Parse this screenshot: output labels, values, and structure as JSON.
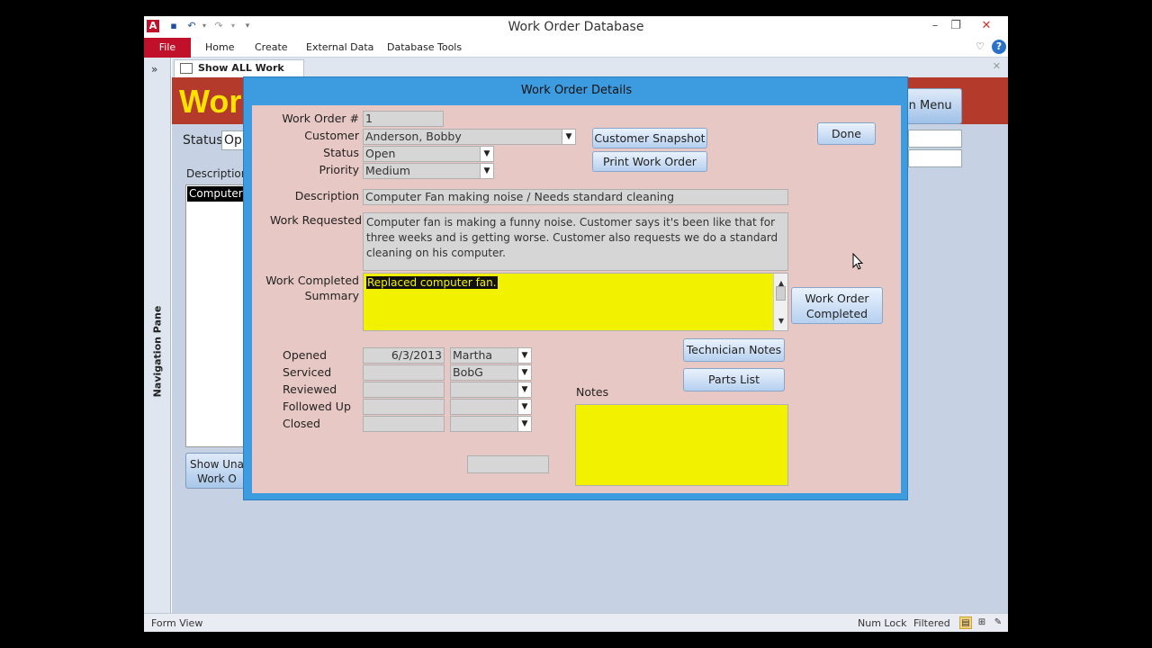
{
  "window": {
    "title": "Work Order Database",
    "qat_icons": [
      "access-icon",
      "save-icon",
      "undo-icon",
      "redo-icon",
      "customize-icon"
    ],
    "controls": [
      "minimize",
      "restore",
      "close"
    ]
  },
  "ribbon": {
    "tabs": [
      "File",
      "Home",
      "Create",
      "External Data",
      "Database Tools"
    ]
  },
  "nav_pane": {
    "toggle": "»",
    "label": "Navigation Pane"
  },
  "doc_tab": {
    "label": "Show ALL Work Orders"
  },
  "background_form": {
    "title": "Wor",
    "main_menu_label": "in Menu",
    "status_label": "Status",
    "status_value": "Op",
    "description_label": "Description",
    "list_selected": "Computer",
    "show_button_line1": "Show Una",
    "show_button_line2": "Work O"
  },
  "dialog": {
    "title": "Work Order Details",
    "labels": {
      "work_order": "Work Order #",
      "customer": "Customer",
      "status": "Status",
      "priority": "Priority",
      "description": "Description",
      "work_requested": "Work Requested",
      "work_completed_line1": "Work Completed",
      "work_completed_line2": "Summary",
      "opened": "Opened",
      "serviced": "Serviced",
      "reviewed": "Reviewed",
      "followed_up": "Followed Up",
      "closed": "Closed",
      "notes": "Notes"
    },
    "values": {
      "work_order": "1",
      "customer": "Anderson, Bobby",
      "status": "Open",
      "priority": "Medium",
      "description": "Computer Fan making noise / Needs standard cleaning",
      "work_requested": "Computer fan is making a funny noise. Customer says it's been like that for three weeks and is getting worse. Customer also requests we do a standard cleaning on his computer.",
      "work_completed": "Replaced computer fan.",
      "opened_date": "6/3/2013",
      "opened_by": "Martha",
      "serviced_date": "",
      "serviced_by": "BobG",
      "reviewed_date": "",
      "reviewed_by": "",
      "followed_up_date": "",
      "followed_up_by": "",
      "closed_date": "",
      "closed_by": "",
      "notes": ""
    },
    "buttons": {
      "customer_snapshot": "Customer Snapshot",
      "print_work_order": "Print Work Order",
      "done": "Done",
      "work_order_completed_line1": "Work Order",
      "work_order_completed_line2": "Completed",
      "technician_notes": "Technician Notes",
      "parts_list": "Parts List"
    }
  },
  "status_bar": {
    "view": "Form View",
    "num_lock": "Num Lock",
    "filtered": "Filtered"
  },
  "colors": {
    "file_tab": "#c0102a",
    "dialog_frame": "#3d9be0",
    "dialog_body": "#e8c8c4",
    "highlight_yellow": "#f2f200",
    "form_header": "#b43a2c",
    "form_title": "#ffe200"
  }
}
